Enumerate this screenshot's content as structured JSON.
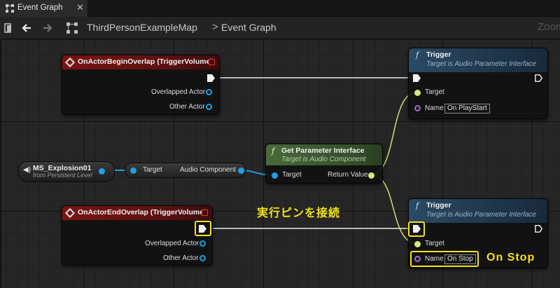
{
  "tab": {
    "label": "Event Graph",
    "close": "✕"
  },
  "breadcrumb": {
    "map": "ThirdPersonExampleMap",
    "separator": ">",
    "graph": "Event Graph"
  },
  "zoom_label": "Zoom",
  "nodes": {
    "begin_overlap": {
      "title": "OnActorBeginOverlap (TriggerVolume)",
      "pins": [
        "Overlapped Actor",
        "Other Actor"
      ]
    },
    "end_overlap": {
      "title": "OnActorEndOverlap (TriggerVolume)",
      "pins": [
        "Overlapped Actor",
        "Other Actor"
      ]
    },
    "variable": {
      "title": "MS_Explosion01",
      "subtitle": "from Persistent Level"
    },
    "converter": {
      "input": "Target",
      "output": "Audio Component"
    },
    "get_param": {
      "title": "Get Parameter Interface",
      "subtitle": "Target is Audio Component",
      "input": "Target",
      "output": "Return Value"
    },
    "trigger_top": {
      "title": "Trigger",
      "subtitle": "Target is Audio Parameter Interface",
      "target_label": "Target",
      "name_label": "Name",
      "name_value": "On PlayStart"
    },
    "trigger_bottom": {
      "title": "Trigger",
      "subtitle": "Target is Audio Parameter Interface",
      "target_label": "Target",
      "name_label": "Name",
      "name_value": "On Stop"
    }
  },
  "annotations": {
    "connect_exec": "実行ピンを接続",
    "on_stop": "On Stop"
  },
  "colors": {
    "highlight": "#f2e21a",
    "exec_wire": "#e8e8e8",
    "object_wire": "#1ea0e6",
    "interface_wire": "#d8e880",
    "name_pin": "#a46cdc"
  }
}
